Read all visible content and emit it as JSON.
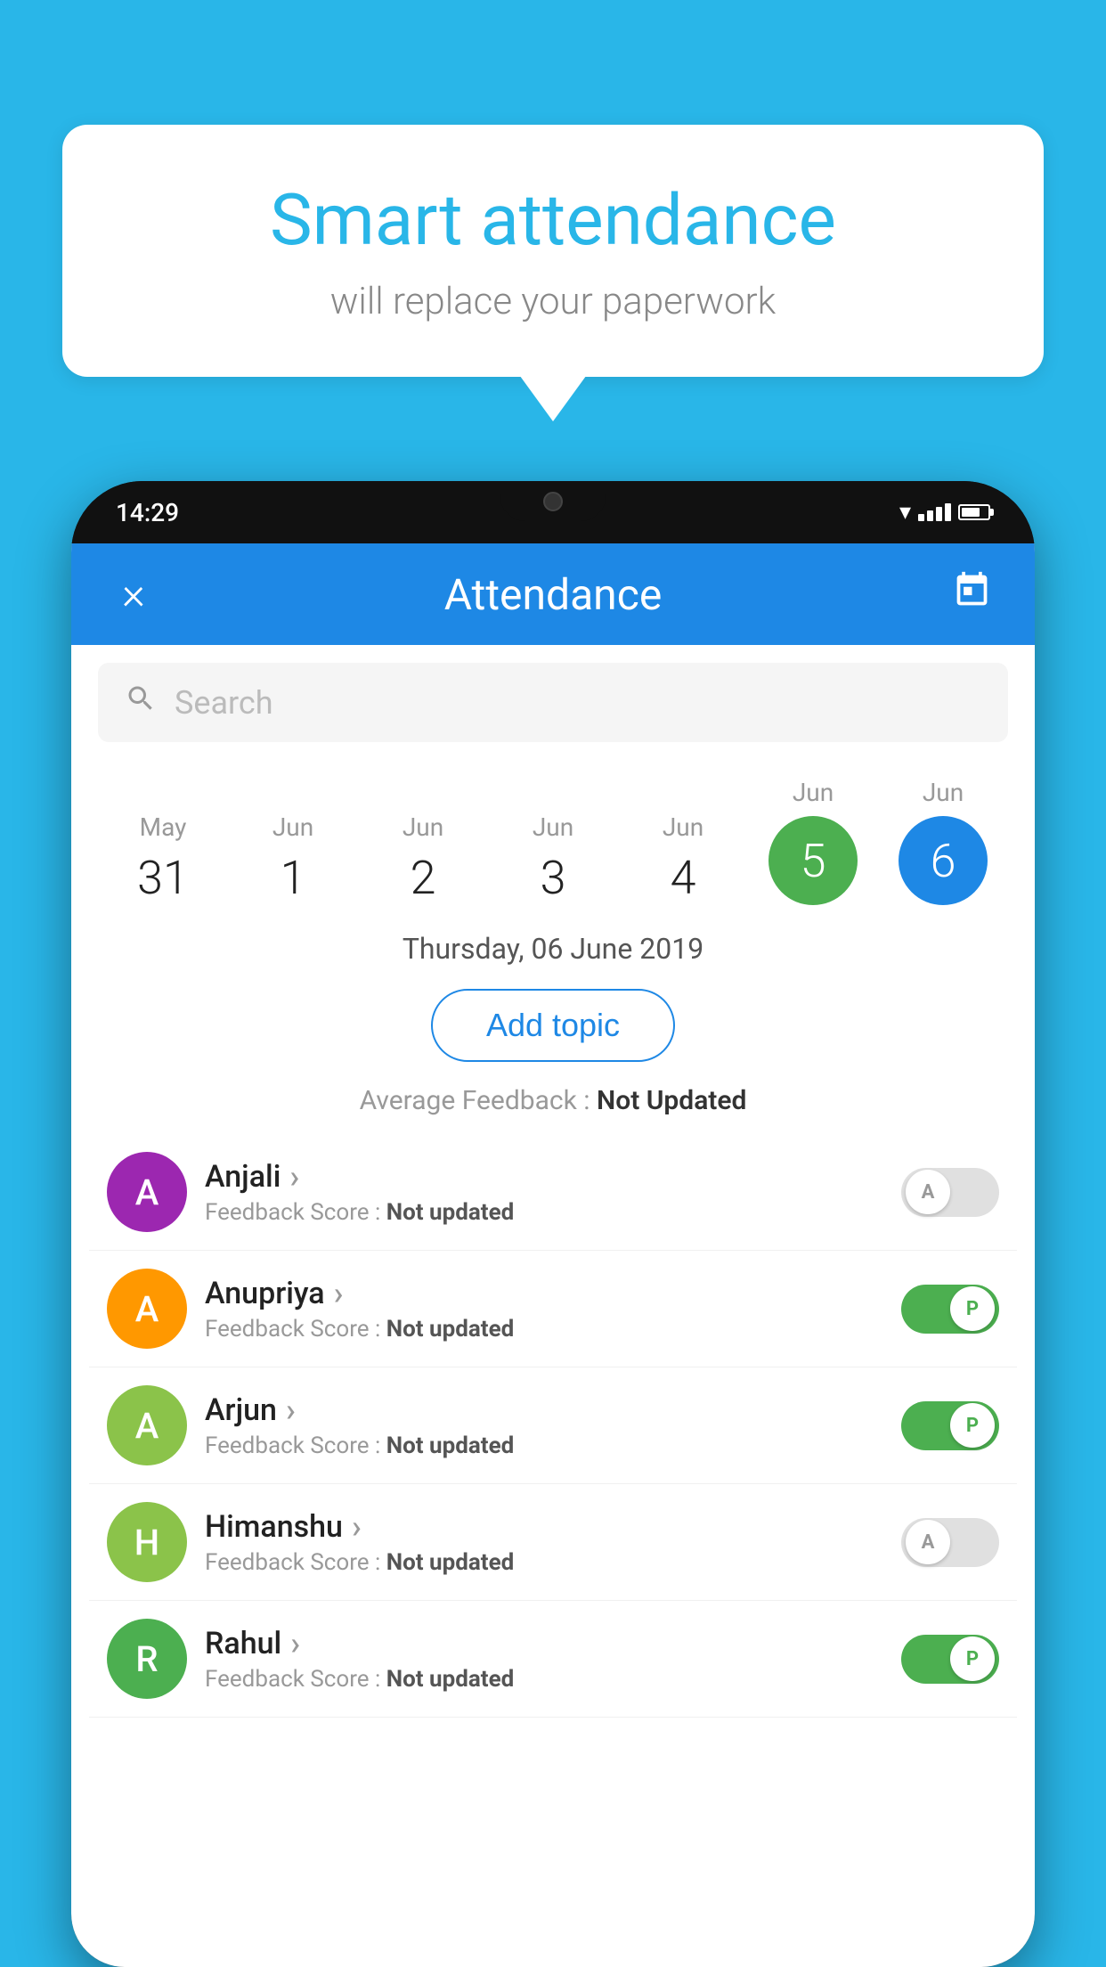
{
  "background_color": "#29b6e8",
  "speech_bubble": {
    "title": "Smart attendance",
    "subtitle": "will replace your paperwork"
  },
  "status_bar": {
    "time": "14:29"
  },
  "app_header": {
    "title": "Attendance",
    "close_label": "×"
  },
  "search": {
    "placeholder": "Search"
  },
  "date_picker": {
    "dates": [
      {
        "month": "May",
        "day": "31",
        "selected": false
      },
      {
        "month": "Jun",
        "day": "1",
        "selected": false
      },
      {
        "month": "Jun",
        "day": "2",
        "selected": false
      },
      {
        "month": "Jun",
        "day": "3",
        "selected": false
      },
      {
        "month": "Jun",
        "day": "4",
        "selected": false
      },
      {
        "month": "Jun",
        "day": "5",
        "selected": "green"
      },
      {
        "month": "Jun",
        "day": "6",
        "selected": "blue"
      }
    ]
  },
  "selected_date_label": "Thursday, 06 June 2019",
  "add_topic_button": "Add topic",
  "average_feedback": {
    "label": "Average Feedback : ",
    "value": "Not Updated"
  },
  "students": [
    {
      "name": "Anjali",
      "avatar_letter": "A",
      "avatar_color": "#9c27b0",
      "feedback_label": "Feedback Score : ",
      "feedback_value": "Not updated",
      "status": "absent"
    },
    {
      "name": "Anupriya",
      "avatar_letter": "A",
      "avatar_color": "#ff9800",
      "feedback_label": "Feedback Score : ",
      "feedback_value": "Not updated",
      "status": "present"
    },
    {
      "name": "Arjun",
      "avatar_letter": "A",
      "avatar_color": "#8bc34a",
      "feedback_label": "Feedback Score : ",
      "feedback_value": "Not updated",
      "status": "present"
    },
    {
      "name": "Himanshu",
      "avatar_letter": "H",
      "avatar_color": "#8bc34a",
      "feedback_label": "Feedback Score : ",
      "feedback_value": "Not updated",
      "status": "absent"
    },
    {
      "name": "Rahul",
      "avatar_letter": "R",
      "avatar_color": "#4caf50",
      "feedback_label": "Feedback Score : ",
      "feedback_value": "Not updated",
      "status": "present"
    }
  ],
  "toggle_labels": {
    "absent": "A",
    "present": "P"
  }
}
